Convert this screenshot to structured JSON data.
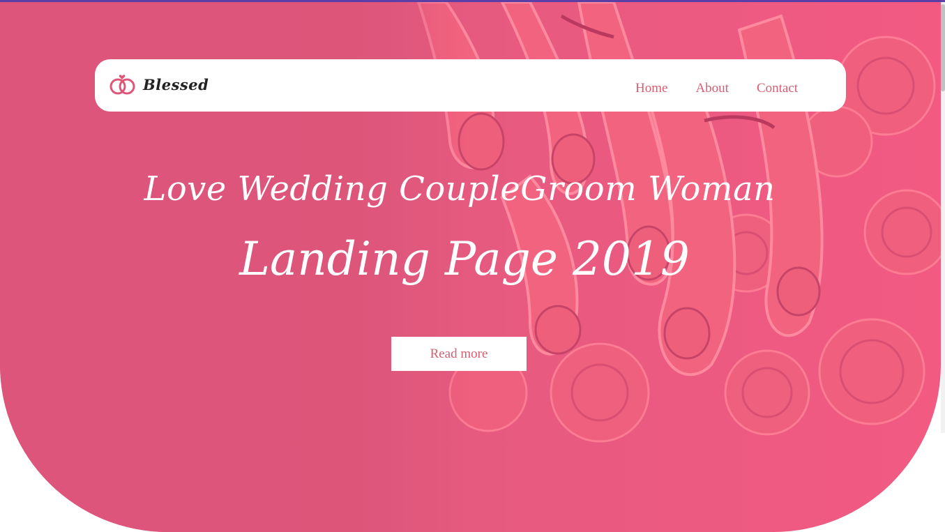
{
  "brand": {
    "name": "Blessed",
    "icon": "wedding-rings-icon",
    "color": "#e05577"
  },
  "nav": {
    "items": [
      "Home",
      "About",
      "Contact"
    ]
  },
  "hero": {
    "line1": "Love Wedding CoupleGroom Woman",
    "line2": "Landing Page 2019",
    "button_label": "Read more",
    "overlay_color": "#e05577",
    "photo": "hands-with-rings-over-roses"
  }
}
